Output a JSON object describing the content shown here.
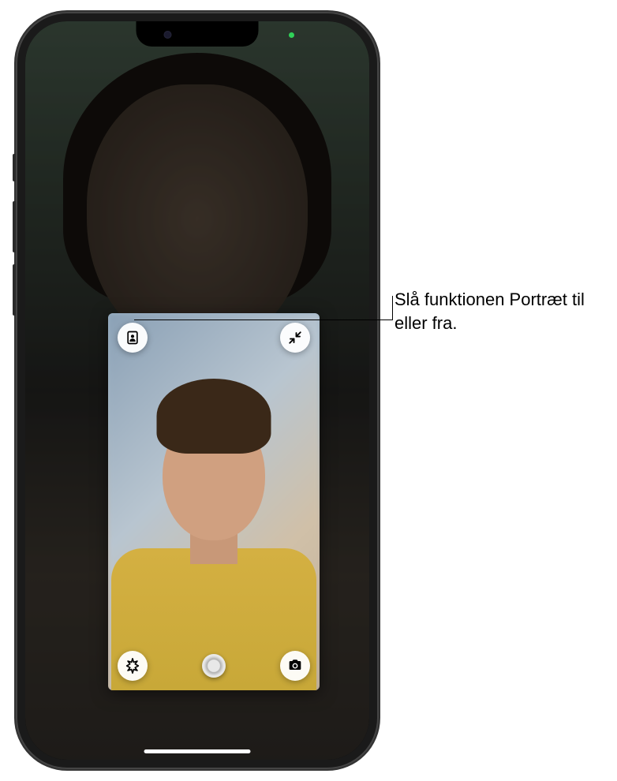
{
  "device": {
    "camera_indicator_color": "#30d158"
  },
  "facetime": {
    "self_view": {
      "buttons": {
        "portrait": {
          "name": "portrait-mode-icon"
        },
        "minimize": {
          "name": "minimize-icon"
        },
        "effects": {
          "name": "effects-icon"
        },
        "flip_camera": {
          "name": "flip-camera-icon"
        }
      }
    }
  },
  "callout": {
    "text": "Slå funktionen Portræt til eller fra."
  }
}
